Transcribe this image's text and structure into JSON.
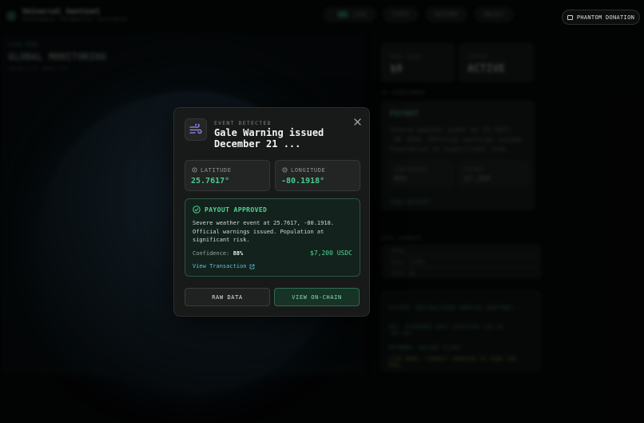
{
  "background": {
    "app_title": "Universal Sentinel",
    "app_subtitle": "Autonomous Parametric Insurance",
    "nav": {
      "live": "LIVE",
      "stats": "STATS",
      "history": "HISTORY",
      "policy": "POLICY"
    },
    "globe_kicker": "LIVE FEED",
    "globe_title": "GLOBAL MONITORING",
    "globe_sub": "SATELLITE ANALYSIS",
    "stat1_label": "POOL SIZE",
    "stat1_value": "$0",
    "stat2_label": "STATUS",
    "stat2_value": "ACTIVE",
    "ai_label": "AI ASSESSMENT",
    "ai_title": "PAYOUT",
    "ai_desc": "Severe weather event at 25.7617, -80.1918. Official warnings issued. Population at significant risk.",
    "ai_conf_label": "CONFIDENCE",
    "ai_conf_value": "88%",
    "ai_payout_label": "PAYOUT",
    "ai_payout_value": "$7,200",
    "ai_link": "VIEW RECEIPT",
    "sources_label": "DATA SOURCES",
    "sources": [
      "NOAA",
      "NASA FIRMS",
      "USGS EQ"
    ],
    "log": [
      "SYSTEM: INITIALIZING ORBITAL SENTINEL...",
      "API: ACQUIRED HOST LOCATION (25.76, -80.19)",
      "NETWORK: ONLINE (LIVE)",
      "LIVE MODE: CONNECT PHANTOM TO FUND THE POOL"
    ]
  },
  "header": {
    "phantom_button": "PHANTOM DONATION"
  },
  "modal": {
    "kicker": "EVENT DETECTED",
    "title": "Gale Warning issued December 21 ...",
    "latitude_label": "LATITUDE",
    "latitude_value": "25.7617°",
    "longitude_label": "LONGITUDE",
    "longitude_value": "-80.1918°",
    "payout_status": "PAYOUT APPROVED",
    "description": "Severe weather event at 25.7617, -80.1918. Official warnings issued. Population at significant risk.",
    "confidence_label": "Confidence:",
    "confidence_value": "88%",
    "amount": "$7,200 USDC",
    "transaction_link": "View Transaction",
    "raw_button": "RAW DATA",
    "chain_button": "VIEW ON-CHAIN"
  },
  "colors": {
    "accent_green": "#4fd495",
    "link_cyan": "#5cc3d8",
    "coord_green": "#4cc98f"
  },
  "icons": [
    "wind-icon",
    "close-icon",
    "location-pin-icon",
    "check-circle-icon",
    "external-link-icon",
    "wallet-icon"
  ]
}
